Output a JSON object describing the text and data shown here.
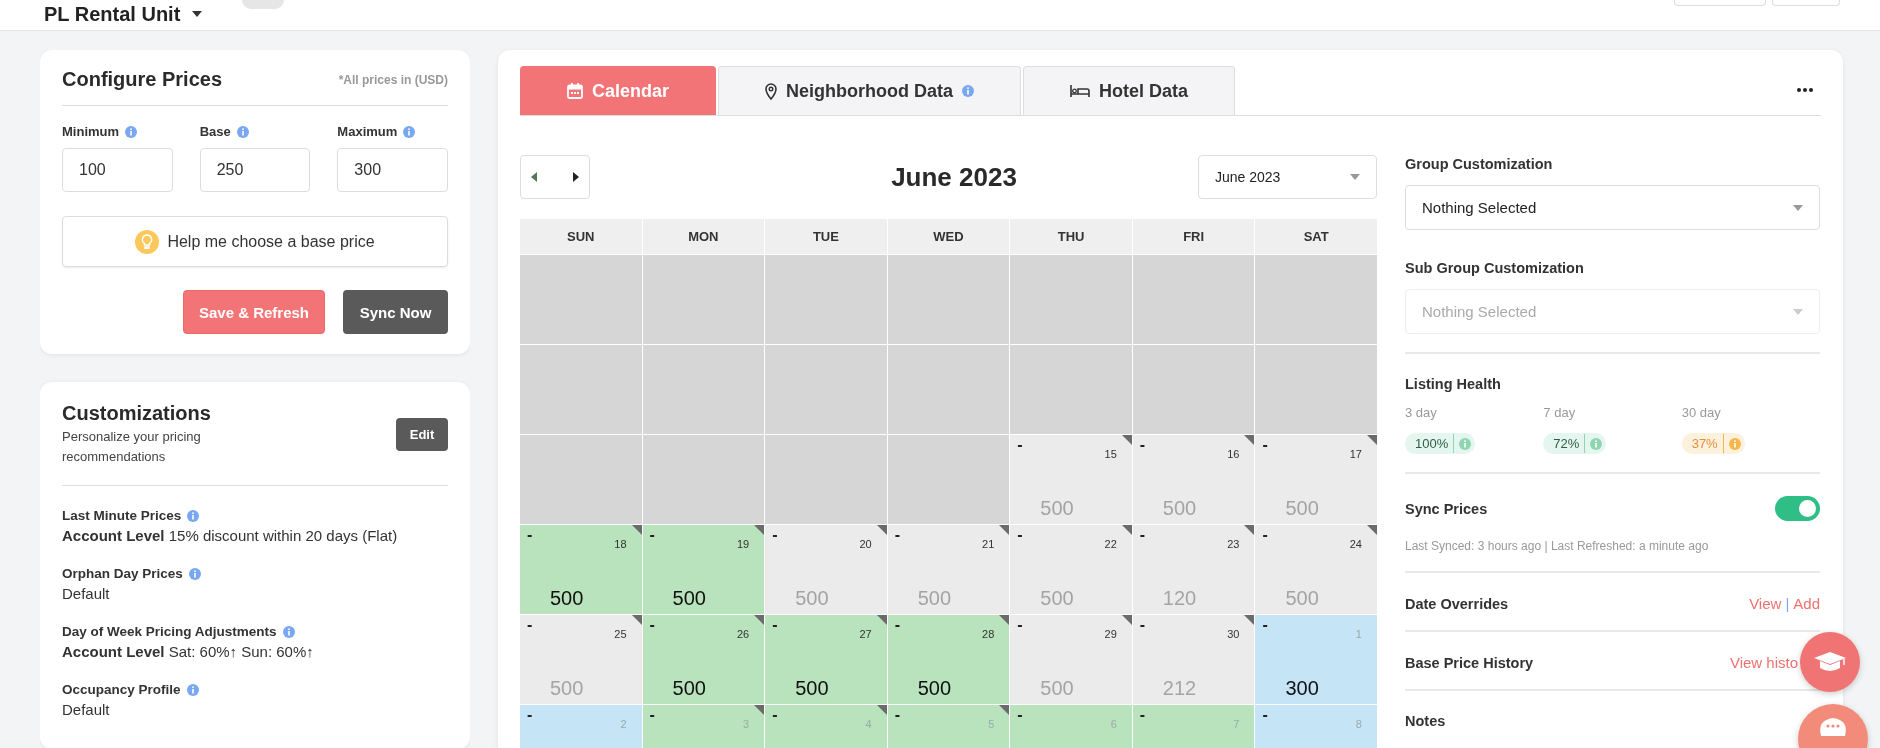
{
  "top_bar": {
    "property": "PL Rental Unit"
  },
  "configure": {
    "title": "Configure Prices",
    "currency_note": "*All prices in (USD)",
    "fields": [
      {
        "label": "Minimum",
        "value": "100",
        "info": true
      },
      {
        "label": "Base",
        "value": "250",
        "info": true
      },
      {
        "label": "Maximum",
        "value": "300",
        "info": true
      }
    ],
    "help_button": "Help me choose a base price",
    "buttons": [
      {
        "label": "Save & Refresh",
        "kind": "primary"
      },
      {
        "label": "Sync Now",
        "kind": "dark"
      }
    ]
  },
  "customizations": {
    "title": "Customizations",
    "subtitle": "Personalize your pricing recommendations",
    "edit_button": "Edit",
    "items": [
      {
        "label": "Last Minute Prices",
        "info": true,
        "value": "**Account Level** 15% discount within 20 days (Flat)"
      },
      {
        "label": "Orphan Day Prices",
        "info": true,
        "value": "Default"
      },
      {
        "label": "Day of Week Pricing Adjustments",
        "info": true,
        "value": "**Account Level** Sat: 60%**↑** Sun: 60%**↑**"
      },
      {
        "label": "Occupancy Profile",
        "info": true,
        "value": "Default"
      }
    ]
  },
  "tabs": [
    {
      "label": "Calendar",
      "selected": true,
      "info": false
    },
    {
      "label": "Neighborhood Data",
      "selected": false,
      "info": true
    },
    {
      "label": "Hotel Data",
      "selected": false,
      "info": false
    }
  ],
  "calendar": {
    "title": "June 2023",
    "month_select": "June 2023",
    "weekdays": [
      "SUN",
      "MON",
      "TUE",
      "WED",
      "THU",
      "FRI",
      "SAT"
    ],
    "rows": [
      [
        {
          "kind": "past"
        },
        {
          "kind": "past"
        },
        {
          "kind": "past"
        },
        {
          "kind": "past"
        },
        {
          "kind": "past"
        },
        {
          "kind": "past"
        },
        {
          "kind": "past"
        }
      ],
      [
        {
          "kind": "past"
        },
        {
          "kind": "past"
        },
        {
          "kind": "past"
        },
        {
          "kind": "past"
        },
        {
          "kind": "past"
        },
        {
          "kind": "past"
        },
        {
          "kind": "past"
        }
      ],
      [
        {
          "kind": "past"
        },
        {
          "kind": "past"
        },
        {
          "kind": "past"
        },
        {
          "kind": "past"
        },
        {
          "kind": "open",
          "marker": "-",
          "day": "15",
          "price": "500",
          "flag": true,
          "next_month": false
        },
        {
          "kind": "open",
          "marker": "-",
          "day": "16",
          "price": "500",
          "flag": true,
          "next_month": false
        },
        {
          "kind": "open",
          "marker": "-",
          "day": "17",
          "price": "500",
          "flag": true,
          "next_month": false
        }
      ],
      [
        {
          "kind": "booked",
          "marker": "-",
          "day": "18",
          "price": "500",
          "flag": true,
          "next_month": false
        },
        {
          "kind": "booked",
          "marker": "-",
          "day": "19",
          "price": "500",
          "flag": true,
          "next_month": false
        },
        {
          "kind": "open",
          "marker": "-",
          "day": "20",
          "price": "500",
          "flag": true,
          "next_month": false
        },
        {
          "kind": "open",
          "marker": "-",
          "day": "21",
          "price": "500",
          "flag": true,
          "next_month": false
        },
        {
          "kind": "open",
          "marker": "-",
          "day": "22",
          "price": "500",
          "flag": true,
          "next_month": false
        },
        {
          "kind": "open",
          "marker": "-",
          "day": "23",
          "price": "120",
          "flag": true,
          "next_month": false
        },
        {
          "kind": "open",
          "marker": "-",
          "day": "24",
          "price": "500",
          "flag": true,
          "next_month": false
        }
      ],
      [
        {
          "kind": "open",
          "marker": "-",
          "day": "25",
          "price": "500",
          "flag": true,
          "next_month": false
        },
        {
          "kind": "booked",
          "marker": "-",
          "day": "26",
          "price": "500",
          "flag": true,
          "next_month": false
        },
        {
          "kind": "booked",
          "marker": "-",
          "day": "27",
          "price": "500",
          "flag": true,
          "next_month": false
        },
        {
          "kind": "booked",
          "marker": "-",
          "day": "28",
          "price": "500",
          "flag": true,
          "next_month": false
        },
        {
          "kind": "open",
          "marker": "-",
          "day": "29",
          "price": "500",
          "flag": true,
          "next_month": false
        },
        {
          "kind": "open",
          "marker": "-",
          "day": "30",
          "price": "212",
          "flag": true,
          "next_month": false
        },
        {
          "kind": "blocked",
          "marker": "-",
          "day": "1",
          "price": "300",
          "flag": false,
          "next_month": true
        }
      ],
      [
        {
          "kind": "blocked",
          "marker": "-",
          "day": "2",
          "flag": false,
          "next_month": true
        },
        {
          "kind": "booked",
          "marker": "-",
          "day": "3",
          "flag": true,
          "next_month": true
        },
        {
          "kind": "booked",
          "marker": "-",
          "day": "4",
          "flag": true,
          "next_month": true
        },
        {
          "kind": "booked",
          "marker": "-",
          "day": "5",
          "flag": true,
          "next_month": true
        },
        {
          "kind": "booked",
          "marker": "-",
          "day": "6",
          "flag": false,
          "next_month": true
        },
        {
          "kind": "booked",
          "marker": "-",
          "day": "7",
          "flag": false,
          "next_month": true
        },
        {
          "kind": "blocked",
          "marker": "-",
          "day": "8",
          "flag": false,
          "next_month": true
        }
      ]
    ]
  },
  "side": {
    "group": {
      "label": "Group Customization",
      "value": "Nothing Selected",
      "disabled": false
    },
    "sub_group": {
      "label": "Sub Group Customization",
      "placeholder": "Nothing Selected",
      "disabled": true
    },
    "health": {
      "title": "Listing Health",
      "periods": [
        {
          "label": "3 day",
          "value": "100%",
          "kind": "good"
        },
        {
          "label": "7 day",
          "value": "72%",
          "kind": "good"
        },
        {
          "label": "30 day",
          "value": "37%",
          "kind": "warning"
        }
      ]
    },
    "sync": {
      "label": "Sync Prices",
      "on": true,
      "note": "Last Synced: 3 hours ago | Last Refreshed: a minute ago"
    },
    "date_overrides": {
      "label": "Date Overrides",
      "links": [
        "View",
        "Add"
      ],
      "separator": "|"
    },
    "base_price_history": {
      "label": "Base Price History",
      "link": "View histo"
    },
    "notes": {
      "label": "Notes"
    }
  }
}
